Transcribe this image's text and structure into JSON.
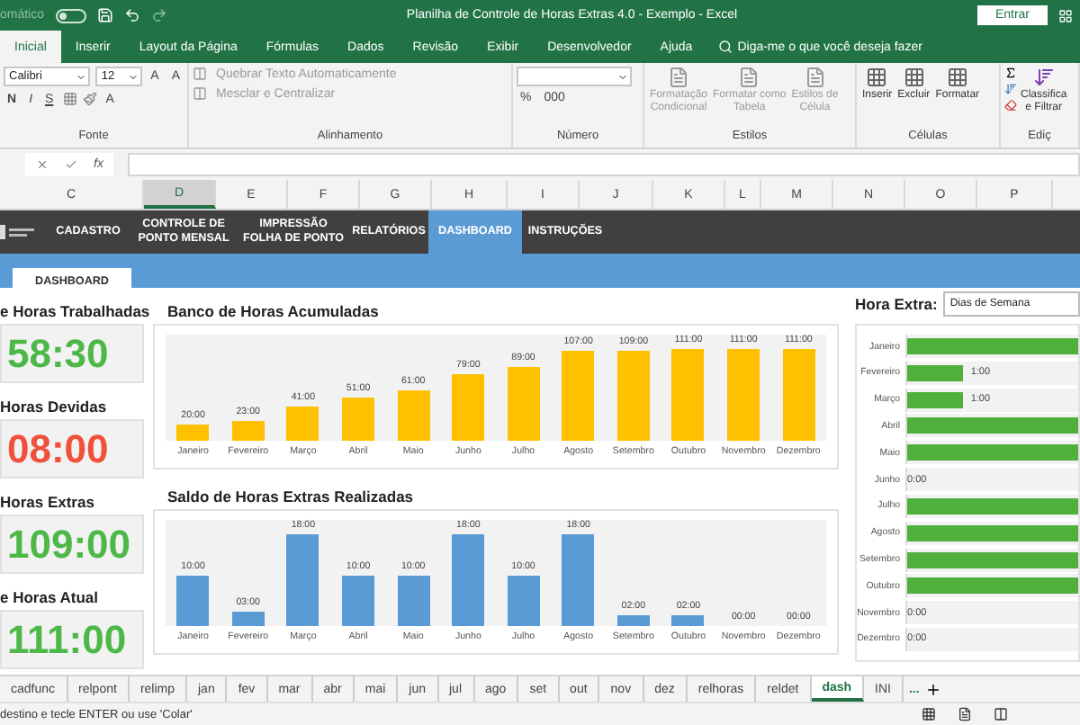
{
  "title_bar": {
    "autosave": {
      "label": "omático",
      "on": false
    },
    "title": "Planilha de Controle de Horas Extras 4.0 - Exemplo  -  Excel",
    "sign_in": "Entrar"
  },
  "ribbon_tabs": [
    {
      "label": "Inicial",
      "selected": true
    },
    {
      "label": "Inserir",
      "selected": false
    },
    {
      "label": "Layout da Página",
      "selected": false
    },
    {
      "label": "Fórmulas",
      "selected": false
    },
    {
      "label": "Dados",
      "selected": false
    },
    {
      "label": "Revisão",
      "selected": false
    },
    {
      "label": "Exibir",
      "selected": false
    },
    {
      "label": "Desenvolvedor",
      "selected": false
    },
    {
      "label": "Ajuda",
      "selected": false
    }
  ],
  "tell_me": "Diga-me o que você deseja fazer",
  "ribbon": {
    "font": {
      "label": "Fonte",
      "name": "Calibri",
      "size": "12",
      "grow": "A",
      "shrink": "A",
      "bold": "N",
      "italic": "I",
      "underline": "S",
      "color_button": "A"
    },
    "alignment": {
      "label": "Alinhamento",
      "wrap": "Quebrar Texto Automaticamente",
      "merge": "Mesclar e Centralizar"
    },
    "number": {
      "label": "Número",
      "percent": "%",
      "thousands": "000"
    },
    "styles": {
      "label": "Estilos",
      "items": [
        "Formatação\nCondicional",
        "Formatar como\nTabela",
        "Estilos de\nCélula"
      ]
    },
    "cells": {
      "label": "Células",
      "items": [
        "Inserir",
        "Excluir",
        "Formatar"
      ]
    },
    "editing": {
      "label": "Ediç",
      "sort": "Classifica\ne Filtrar"
    }
  },
  "formula_bar": {
    "function_label": "fx"
  },
  "columns": [
    {
      "label": "C",
      "selected": false
    },
    {
      "label": "D",
      "selected": true
    },
    {
      "label": "E",
      "selected": false
    },
    {
      "label": "F",
      "selected": false
    },
    {
      "label": "G",
      "selected": false
    },
    {
      "label": "H",
      "selected": false
    },
    {
      "label": "I",
      "selected": false
    },
    {
      "label": "J",
      "selected": false
    },
    {
      "label": "K",
      "selected": false
    },
    {
      "label": "L",
      "selected": false
    },
    {
      "label": "M",
      "selected": false
    },
    {
      "label": "N",
      "selected": false
    },
    {
      "label": "O",
      "selected": false
    },
    {
      "label": "P",
      "selected": false
    }
  ],
  "nav": [
    {
      "label": "CADASTRO",
      "selected": false
    },
    {
      "label": "CONTROLE DE\nPONTO MENSAL",
      "selected": false
    },
    {
      "label": "IMPRESSÃO\nFOLHA DE PONTO",
      "selected": false
    },
    {
      "label": "RELATÓRIOS",
      "selected": false
    },
    {
      "label": "DASHBOARD",
      "selected": true
    },
    {
      "label": "INSTRUÇÕES",
      "selected": false
    }
  ],
  "page_tab": "DASHBOARD",
  "cards": [
    {
      "title": "e Horas Trabalhadas",
      "value": "58:30",
      "color": "#4db848"
    },
    {
      "title": "Horas Devidas",
      "value": "08:00",
      "color": "#f0503c"
    },
    {
      "title": "Horas Extras",
      "value": "109:00",
      "color": "#4db848"
    },
    {
      "title": "e Horas Atual",
      "value": "111:00",
      "color": "#4db848"
    }
  ],
  "charts": [
    {
      "title": "Banco de Horas Acumuladas",
      "color": "#ffc000",
      "bars": [
        {
          "month": "Janeiro",
          "reading": "20:00",
          "level": 0.16
        },
        {
          "month": "Fevereiro",
          "reading": "23:00",
          "level": 0.18
        },
        {
          "month": "Março",
          "reading": "41:00",
          "level": 0.32
        },
        {
          "month": "Abril",
          "reading": "51:00",
          "level": 0.4
        },
        {
          "month": "Maio",
          "reading": "61:00",
          "level": 0.48
        },
        {
          "month": "Junho",
          "reading": "79:00",
          "level": 0.62
        },
        {
          "month": "Julho",
          "reading": "89:00",
          "level": 0.7
        },
        {
          "month": "Agosto",
          "reading": "107:00",
          "level": 0.84
        },
        {
          "month": "Setembro",
          "reading": "109:00",
          "level": 0.85
        },
        {
          "month": "Outubro",
          "reading": "111:00",
          "level": 0.87
        },
        {
          "month": "Novembro",
          "reading": "111:00",
          "level": 0.87
        },
        {
          "month": "Dezembro",
          "reading": "111:00",
          "level": 0.87
        }
      ]
    },
    {
      "title": "Saldo de Horas Extras Realizadas",
      "color": "#5b9bd5",
      "bars": [
        {
          "month": "Janeiro",
          "reading": "10:00",
          "level": 0.48
        },
        {
          "month": "Fevereiro",
          "reading": "03:00",
          "level": 0.14
        },
        {
          "month": "Março",
          "reading": "18:00",
          "level": 0.86
        },
        {
          "month": "Abril",
          "reading": "10:00",
          "level": 0.48
        },
        {
          "month": "Maio",
          "reading": "10:00",
          "level": 0.48
        },
        {
          "month": "Junho",
          "reading": "18:00",
          "level": 0.86
        },
        {
          "month": "Julho",
          "reading": "10:00",
          "level": 0.48
        },
        {
          "month": "Agosto",
          "reading": "18:00",
          "level": 0.86
        },
        {
          "month": "Setembro",
          "reading": "02:00",
          "level": 0.1
        },
        {
          "month": "Outubro",
          "reading": "02:00",
          "level": 0.1
        },
        {
          "month": "Novembro",
          "reading": "00:00"
        },
        {
          "month": "Dezembro",
          "reading": "00:00"
        }
      ]
    }
  ],
  "hora_extra": {
    "label": "Hora Extra:",
    "value": "Dias de Semana",
    "rows": [
      {
        "month": "Janeiro",
        "level": 1
      },
      {
        "month": "Fevereiro",
        "level": 0.33,
        "reading": "1:00"
      },
      {
        "month": "Março",
        "level": 0.33,
        "reading": "1:00"
      },
      {
        "month": "Abril",
        "level": 1
      },
      {
        "month": "Maio",
        "level": 1
      },
      {
        "month": "Junho",
        "reading": "0:00"
      },
      {
        "month": "Julho",
        "level": 1
      },
      {
        "month": "Agosto",
        "level": 1
      },
      {
        "month": "Setembro",
        "level": 1
      },
      {
        "month": "Outubro",
        "level": 1
      },
      {
        "month": "Novembro",
        "reading": "0:00"
      },
      {
        "month": "Dezembro",
        "reading": "0:00"
      }
    ]
  },
  "sheet_tabs": [
    {
      "label": "cadfunc",
      "selected": false
    },
    {
      "label": "relpont",
      "selected": false
    },
    {
      "label": "relimp",
      "selected": false
    },
    {
      "label": "jan",
      "selected": false
    },
    {
      "label": "fev",
      "selected": false
    },
    {
      "label": "mar",
      "selected": false
    },
    {
      "label": "abr",
      "selected": false
    },
    {
      "label": "mai",
      "selected": false
    },
    {
      "label": "jun",
      "selected": false
    },
    {
      "label": "jul",
      "selected": false
    },
    {
      "label": "ago",
      "selected": false
    },
    {
      "label": "set",
      "selected": false
    },
    {
      "label": "out",
      "selected": false
    },
    {
      "label": "nov",
      "selected": false
    },
    {
      "label": "dez",
      "selected": false
    },
    {
      "label": "relhoras",
      "selected": false
    },
    {
      "label": "reldet",
      "selected": false
    },
    {
      "label": "dash",
      "selected": true
    },
    {
      "label": "INI",
      "selected": false
    }
  ],
  "more_tabs": "...",
  "status": "destino e tecle ENTER ou use 'Colar'"
}
